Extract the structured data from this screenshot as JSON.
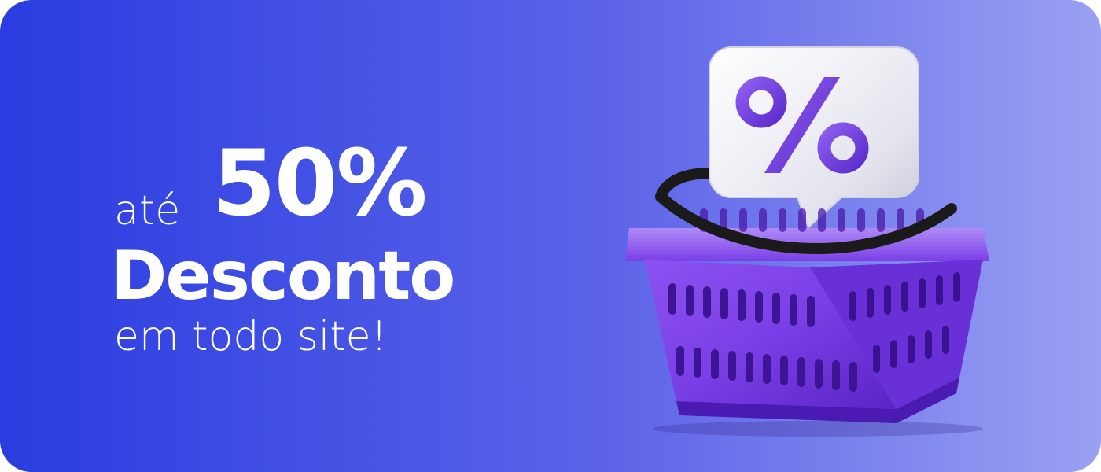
{
  "promo": {
    "prefix": "até",
    "amount": "50%",
    "title": "Desconto",
    "subtitle": "em todo site!"
  },
  "icons": {
    "basket": "shopping-basket-icon",
    "badge": "percent-badge-icon"
  },
  "colors": {
    "gradient_start": "#2b3ce0",
    "gradient_end": "#9aa1f2",
    "basket": "#7a3fe6",
    "badge": "#ececf4",
    "percent_sign": "#7440e0",
    "text": "#ffffff"
  }
}
